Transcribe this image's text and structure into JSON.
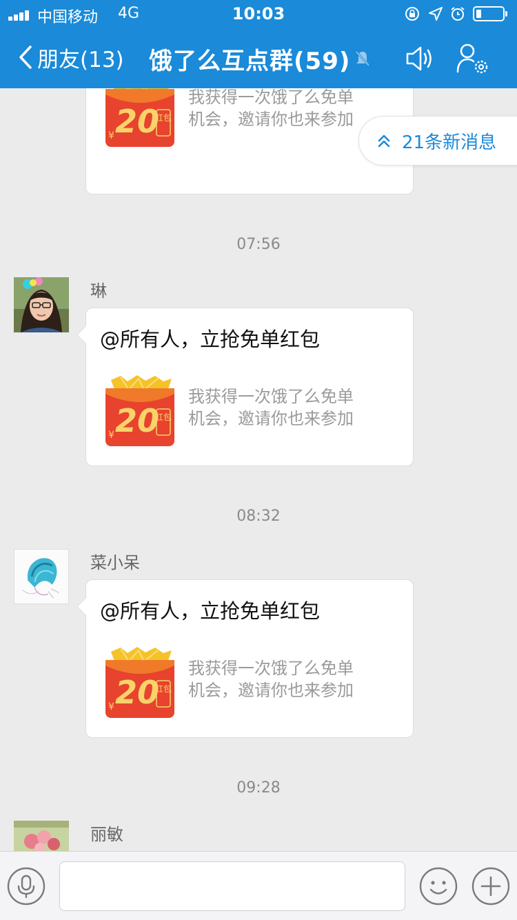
{
  "status_bar": {
    "carrier": "中国移动",
    "network": "4G",
    "time": "10:03",
    "battery_level": 0.2
  },
  "nav": {
    "back_label": "朋友(13)",
    "title": "饿了么互点群(59)"
  },
  "new_messages_pill": {
    "label": "21条新消息"
  },
  "messages": [
    {
      "card_amount": "20",
      "card_unit": "¥",
      "card_tag": "红包",
      "card_desc_line1": "我获得一次饿了么免单",
      "card_desc_line2": "机会，邀请你也来参加"
    },
    {
      "time": "07:56",
      "sender": "琳",
      "text": "@所有人，立抢免单红包",
      "card_amount": "20",
      "card_unit": "¥",
      "card_tag": "红包",
      "card_desc_line1": "我获得一次饿了么免单",
      "card_desc_line2": "机会，邀请你也来参加"
    },
    {
      "time": "08:32",
      "sender": "菜小呆",
      "text": "@所有人，立抢免单红包",
      "card_amount": "20",
      "card_unit": "¥",
      "card_tag": "红包",
      "card_desc_line1": "我获得一次饿了么免单",
      "card_desc_line2": "机会，邀请你也来参加"
    },
    {
      "time": "09:28",
      "sender": "丽敏"
    }
  ],
  "input_bar": {
    "placeholder": "",
    "value": ""
  },
  "colors": {
    "header_blue": "#1a8ad9",
    "chat_bg": "#ebebeb",
    "pill_text": "#1a8ad9",
    "envelope_red": "#e8432e",
    "envelope_gold": "#f5c228"
  }
}
